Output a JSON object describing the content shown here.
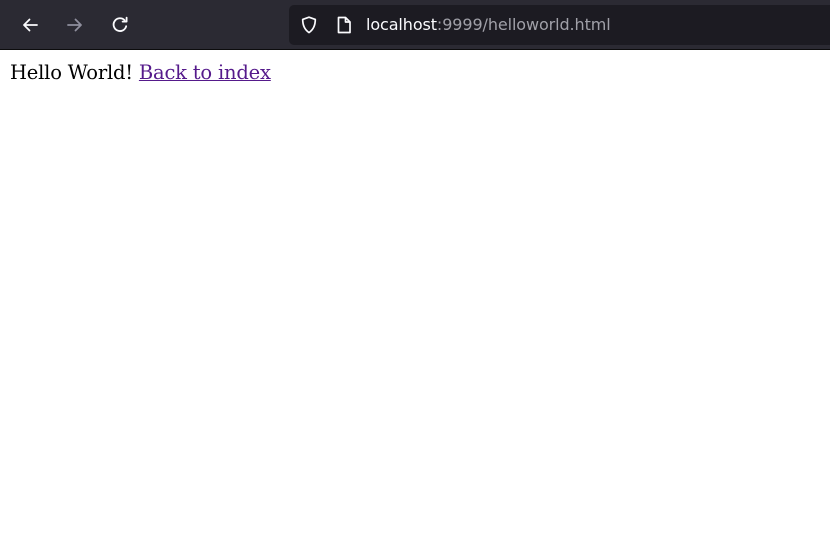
{
  "browser": {
    "url_host": "localhost",
    "url_path": ":9999/helloworld.html",
    "icons": {
      "back": "back-arrow-icon",
      "forward": "forward-arrow-icon",
      "reload": "reload-icon",
      "tracking": "shield-icon",
      "page": "page-icon"
    },
    "colors": {
      "toolbar": "#2b2a33",
      "urlbar": "#1c1b22",
      "icon_active": "#fbfbfe",
      "icon_disabled": "#8f8f9d"
    }
  },
  "page": {
    "greeting": "Hello World!",
    "link_label": "Back to index",
    "colors": {
      "text": "#000000",
      "visited_link": "#551a8b"
    }
  }
}
